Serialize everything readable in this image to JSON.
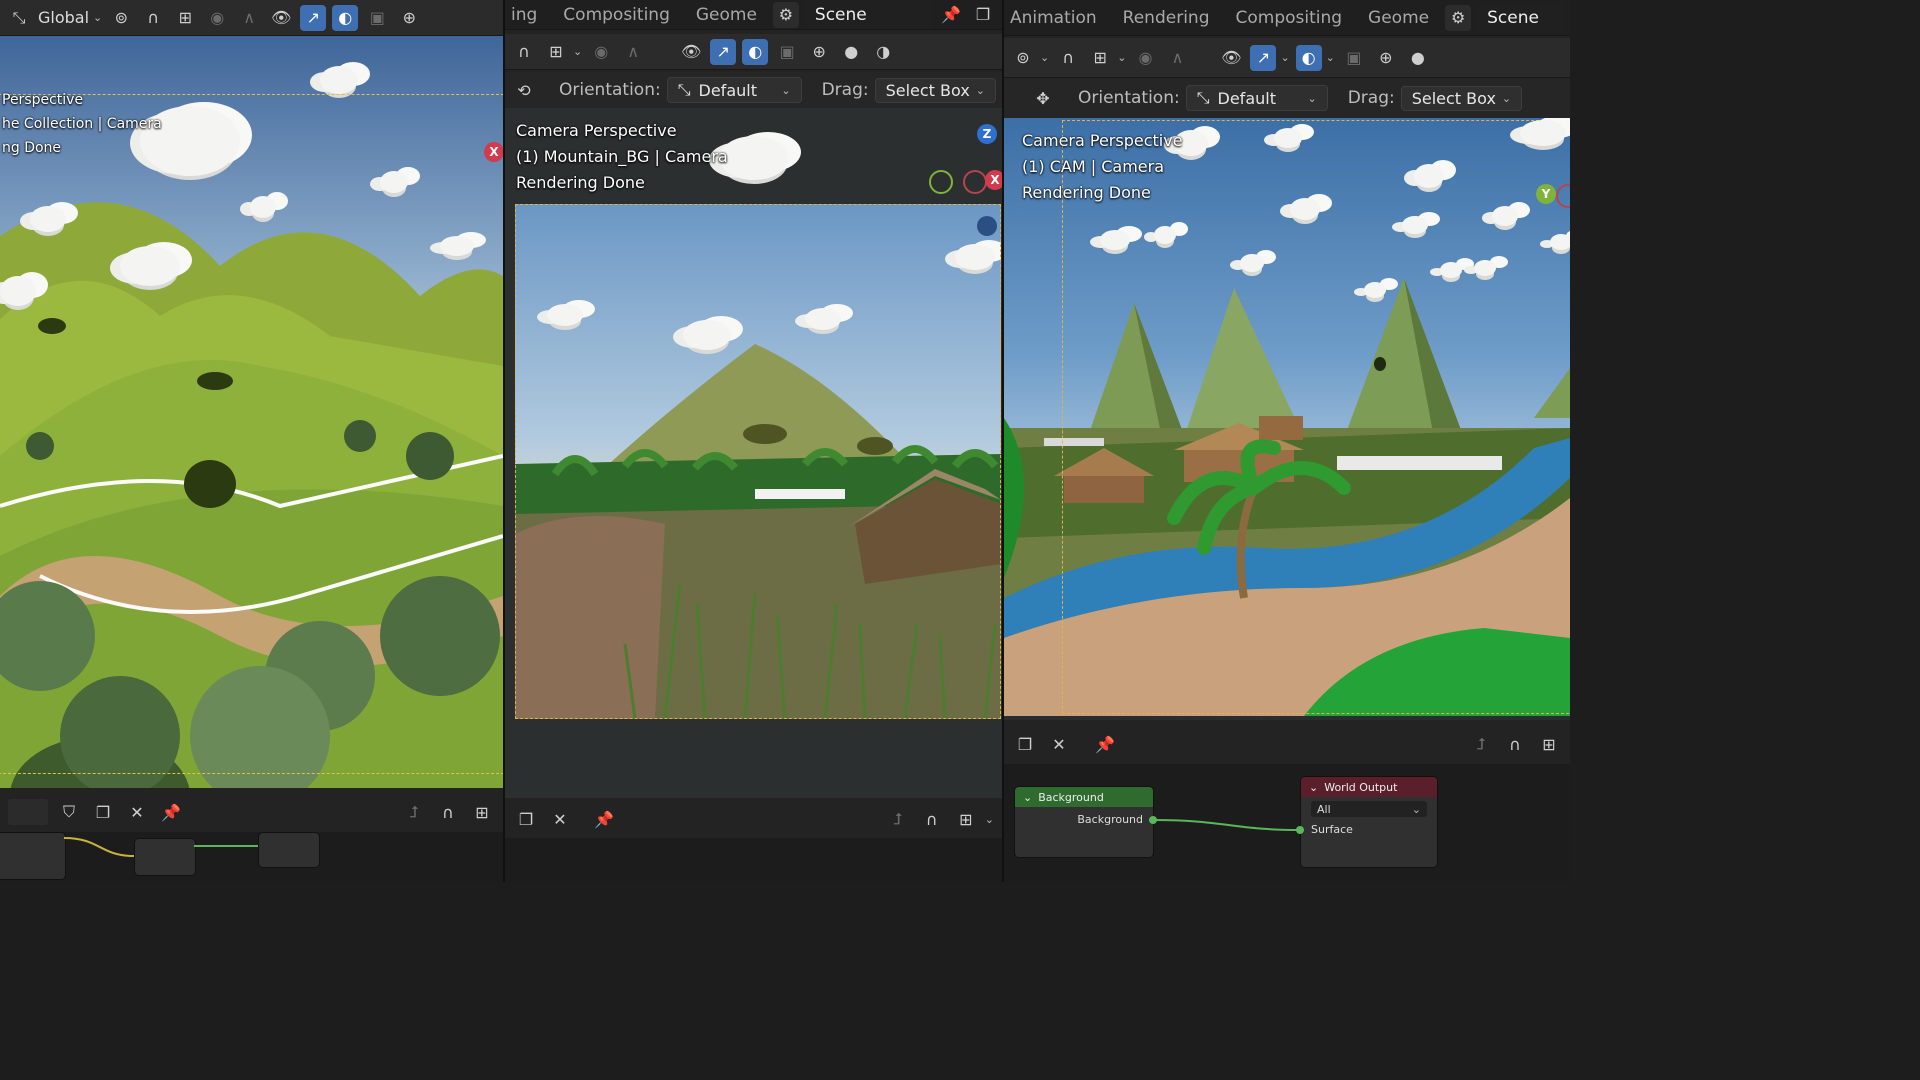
{
  "left": {
    "orientation_value": "Global",
    "overlay": {
      "line1": "Perspective",
      "line2": "he Collection | Camera",
      "line3": "ng Done"
    },
    "gizmo_x": "X"
  },
  "middle": {
    "workspace_tabs": [
      "ing",
      "Compositing",
      "Geome"
    ],
    "scene": "Scene",
    "orientation_label": "Orientation:",
    "orientation_value": "Default",
    "drag_label": "Drag:",
    "drag_value": "Select Box",
    "overlay": {
      "line1": "Camera Perspective",
      "line2": "(1) Mountain_BG | Camera",
      "line3": "Rendering Done"
    },
    "gizmo": {
      "z": "Z",
      "x": "X"
    }
  },
  "right": {
    "workspace_tabs": [
      "Animation",
      "Rendering",
      "Compositing",
      "Geome"
    ],
    "scene": "Scene",
    "orientation_label": "Orientation:",
    "orientation_value": "Default",
    "drag_label": "Drag:",
    "drag_value": "Select Box",
    "overlay": {
      "line1": "Camera Perspective",
      "line2": "(1) CAM | Camera",
      "line3": "Rendering Done"
    },
    "gizmo_y": "Y",
    "nodes": {
      "background_title": "Background",
      "background_output": "Background",
      "world_output_title": "World Output",
      "world_output_target": "All",
      "surface_label": "Surface"
    }
  },
  "colors": {
    "accent_blue": "#3f6fb3",
    "camera_frame": "#e0b24a",
    "node_green": "#2f6b2f",
    "node_world_output": "#5a1f2b"
  }
}
